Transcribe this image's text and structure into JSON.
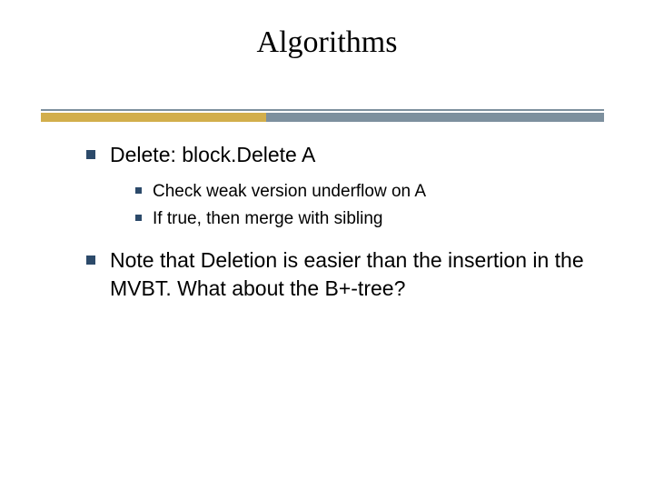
{
  "title": "Algorithms",
  "bullets": [
    {
      "text": "Delete: block.Delete A",
      "children": [
        {
          "text": "Check weak version underflow on A"
        },
        {
          "text": "If true, then merge with sibling"
        }
      ]
    },
    {
      "text": "Note that Deletion is easier than the insertion in the MVBT. What about the B+-tree?"
    }
  ]
}
